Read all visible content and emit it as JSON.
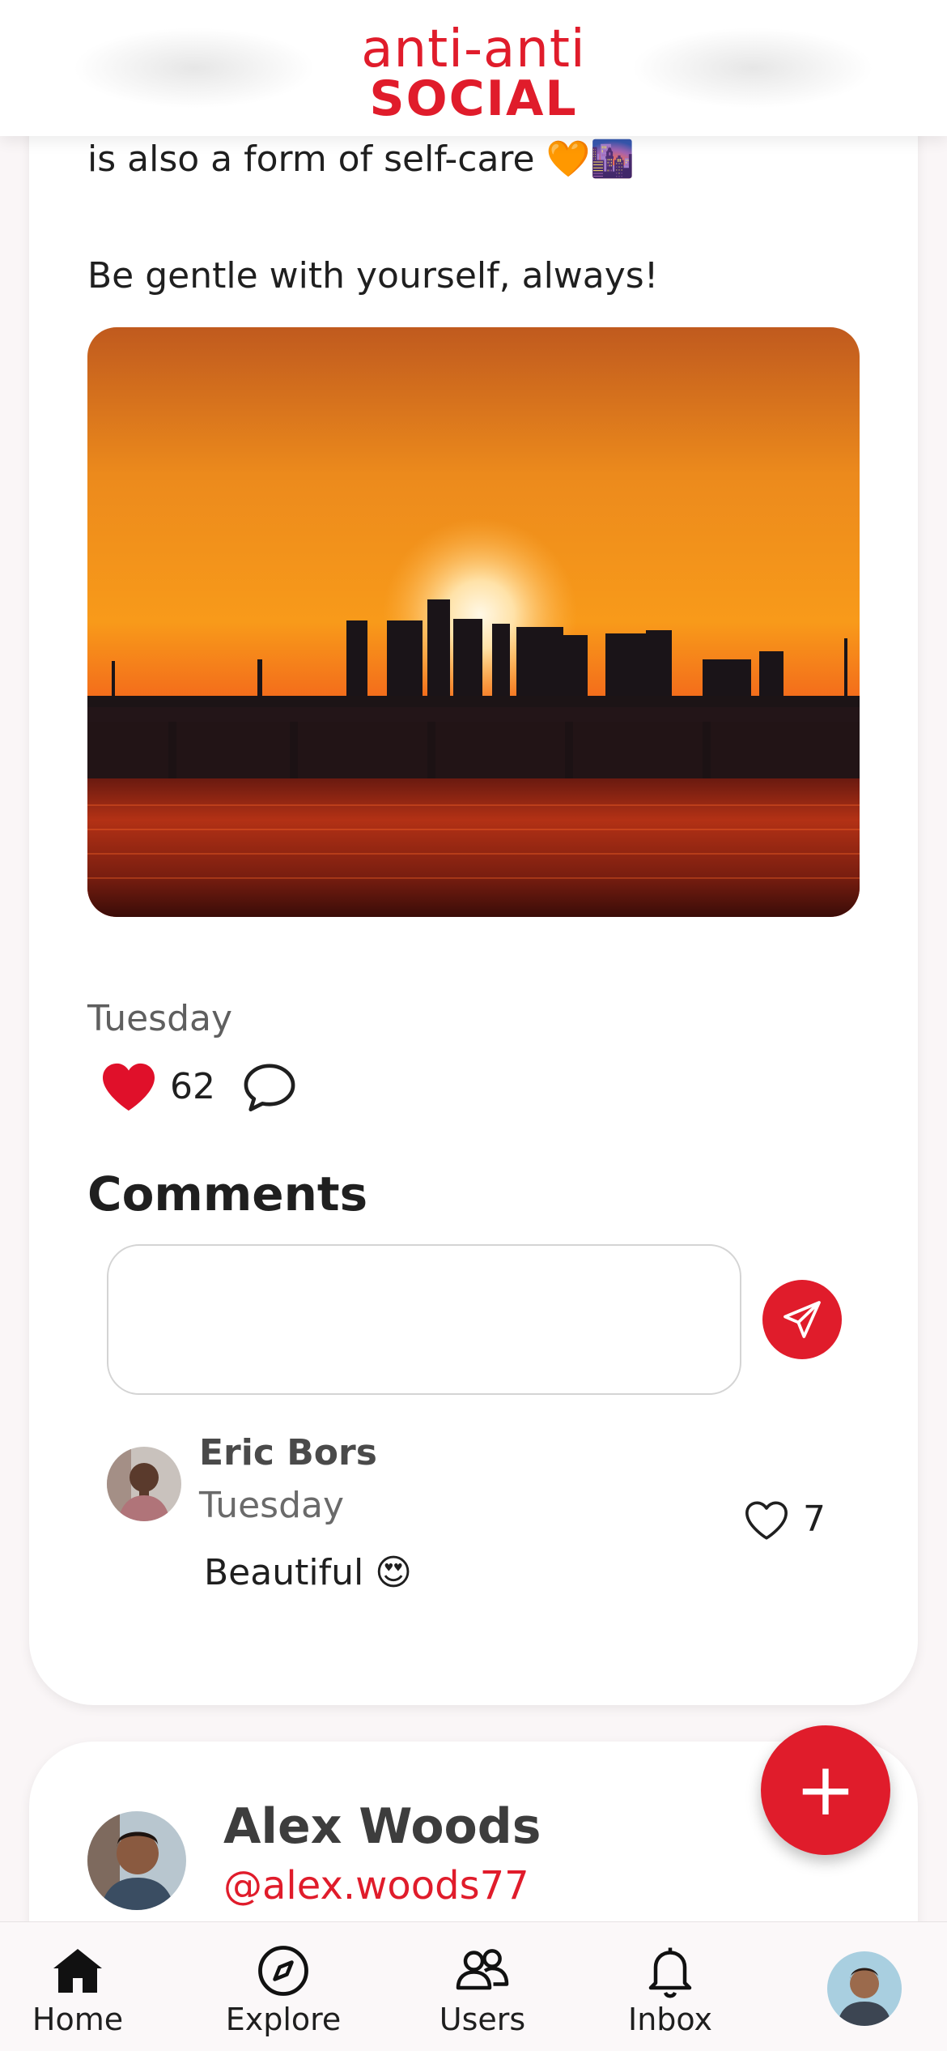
{
  "header": {
    "logo_line1": "anti-anti",
    "logo_line2": "SOCIAL"
  },
  "post": {
    "text_line1": "is also a form of self-care 🧡🌆",
    "text_line2": "Be gentle with yourself, always!",
    "date": "Tuesday",
    "likes": "62",
    "comments_heading": "Comments",
    "comment_input_value": "",
    "comments": [
      {
        "author": "Eric Bors",
        "date": "Tuesday",
        "text": "Beautiful 😍",
        "likes": "7"
      }
    ]
  },
  "next_post": {
    "name": "Alex Woods",
    "handle": "@alex.woods77"
  },
  "fab": {
    "label": "+"
  },
  "nav": {
    "home": "Home",
    "explore": "Explore",
    "users": "Users",
    "inbox": "Inbox"
  },
  "colors": {
    "accent": "#e01c2b",
    "background": "#faf6f7"
  }
}
